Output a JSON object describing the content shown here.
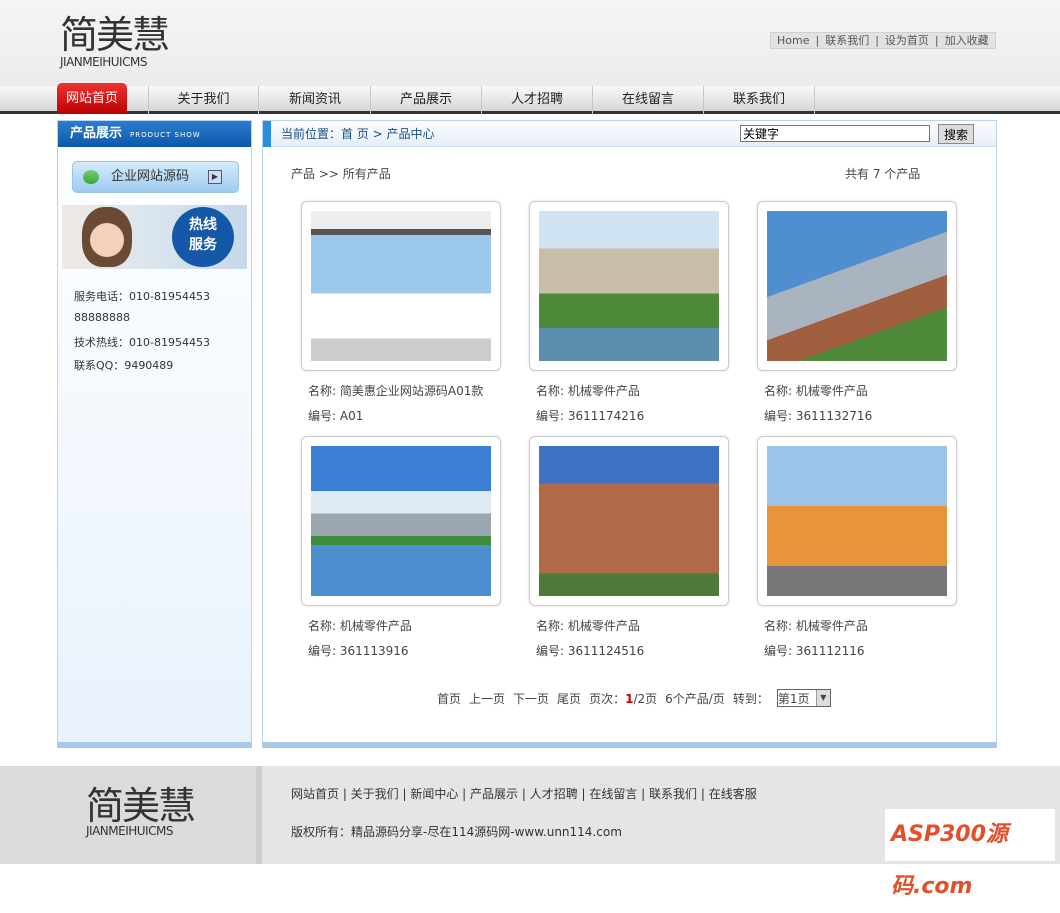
{
  "header": {
    "logo_cn": "简美慧",
    "logo_en": "JIANMEIHUICMS",
    "top_links": [
      "Home",
      "|",
      "联系我们",
      "|",
      "设为首页",
      "|",
      "加入收藏"
    ]
  },
  "nav": [
    "网站首页",
    "关于我们",
    "新闻资讯",
    "产品展示",
    "人才招聘",
    "在线留言",
    "联系我们"
  ],
  "sidebar": {
    "title": "产品展示",
    "title_en": "PRODUCT SHOW",
    "category": "企业网站源码",
    "hotline_badge": "热线服务",
    "contacts": [
      "服务电话：010-81954453",
      "88888888",
      "技术热线：010-81954453",
      "联系QQ：9490489"
    ]
  },
  "main": {
    "crumb": "当前位置：首 页 > 产品中心",
    "search_placeholder": "关键字",
    "search_btn": "搜索",
    "path": "产品 >> 所有产品",
    "total": "共有 7 个产品",
    "products": [
      {
        "name": "名称: 简美惠企业网站源码A01款",
        "code": "编号: A01"
      },
      {
        "name": "名称: 机械零件产品",
        "code": "编号: 3611174216"
      },
      {
        "name": "名称: 机械零件产品",
        "code": "编号: 3611132716"
      },
      {
        "name": "名称: 机械零件产品",
        "code": "编号: 361113916"
      },
      {
        "name": "名称: 机械零件产品",
        "code": "编号: 3611124516"
      },
      {
        "name": "名称: 机械零件产品",
        "code": "编号: 361112116"
      }
    ],
    "pager": {
      "first": "首页",
      "prev": "上一页",
      "next": "下一页",
      "last": "尾页",
      "page_label": "页次：",
      "current": "1",
      "total": "/2页",
      "per_page": "6个产品/页",
      "goto": "转到：",
      "select": "第1页"
    }
  },
  "footer": {
    "logo_cn": "简美慧",
    "logo_en": "JIANMEIHUICMS",
    "links": "网站首页 | 关于我们 | 新闻中心 | 产品展示 | 人才招聘  | 在线留言 | 联系我们 | 在线客服",
    "copyright": "版权所有：精品源码分享-尽在114源码网-www.unn114.com",
    "badge": "ASP300源码.com"
  }
}
